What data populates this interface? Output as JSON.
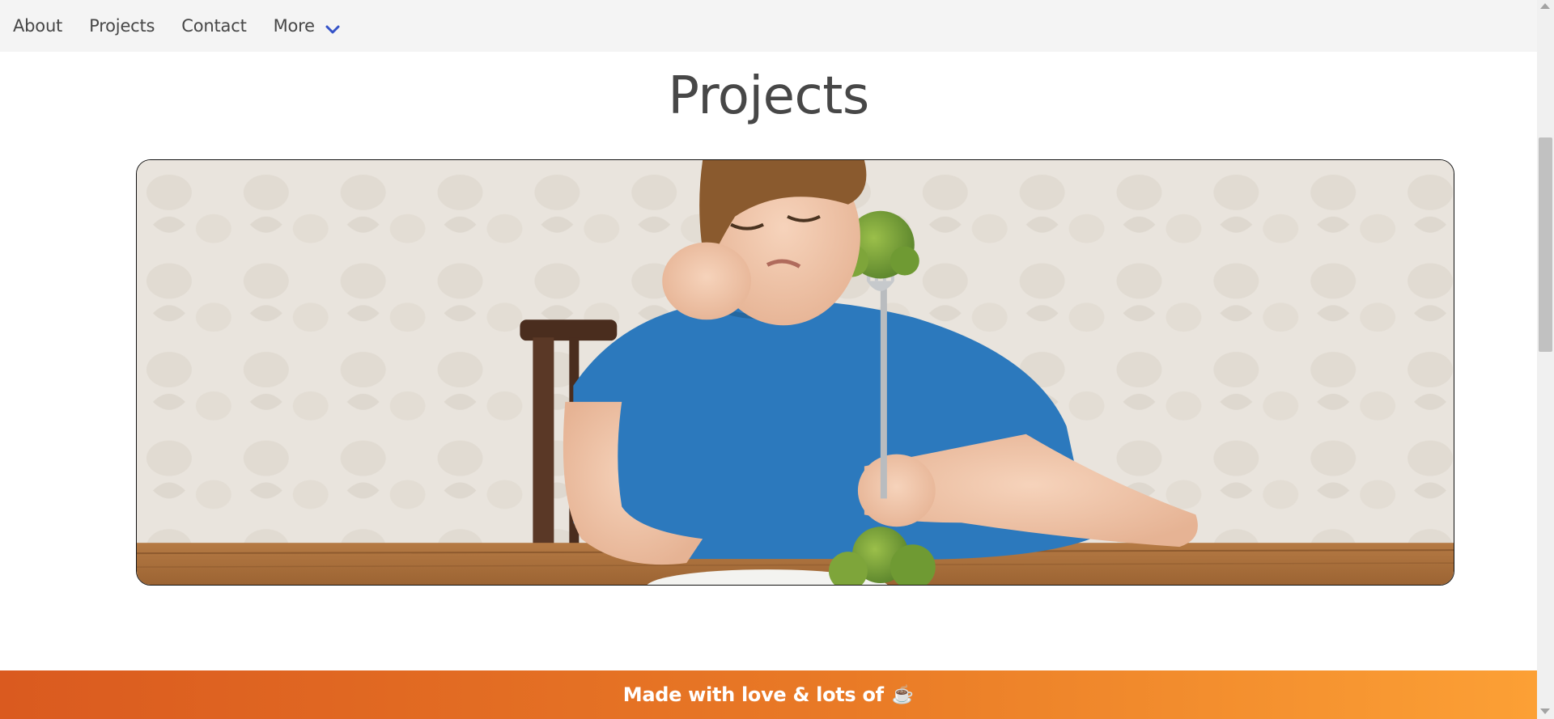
{
  "nav": {
    "items": [
      {
        "label": "About"
      },
      {
        "label": "Projects"
      },
      {
        "label": "Contact"
      },
      {
        "label": "More",
        "icon": "chevron-down-icon"
      }
    ],
    "accent_color": "#3553c8"
  },
  "main": {
    "title": "Projects",
    "hero_image": {
      "subject": "boy-with-broccoli-photo"
    }
  },
  "footer": {
    "text": "Made with love & lots of",
    "icon": "coffee-icon",
    "icon_glyph": "☕",
    "gradient": [
      "#da5a1f",
      "#fca035"
    ]
  }
}
